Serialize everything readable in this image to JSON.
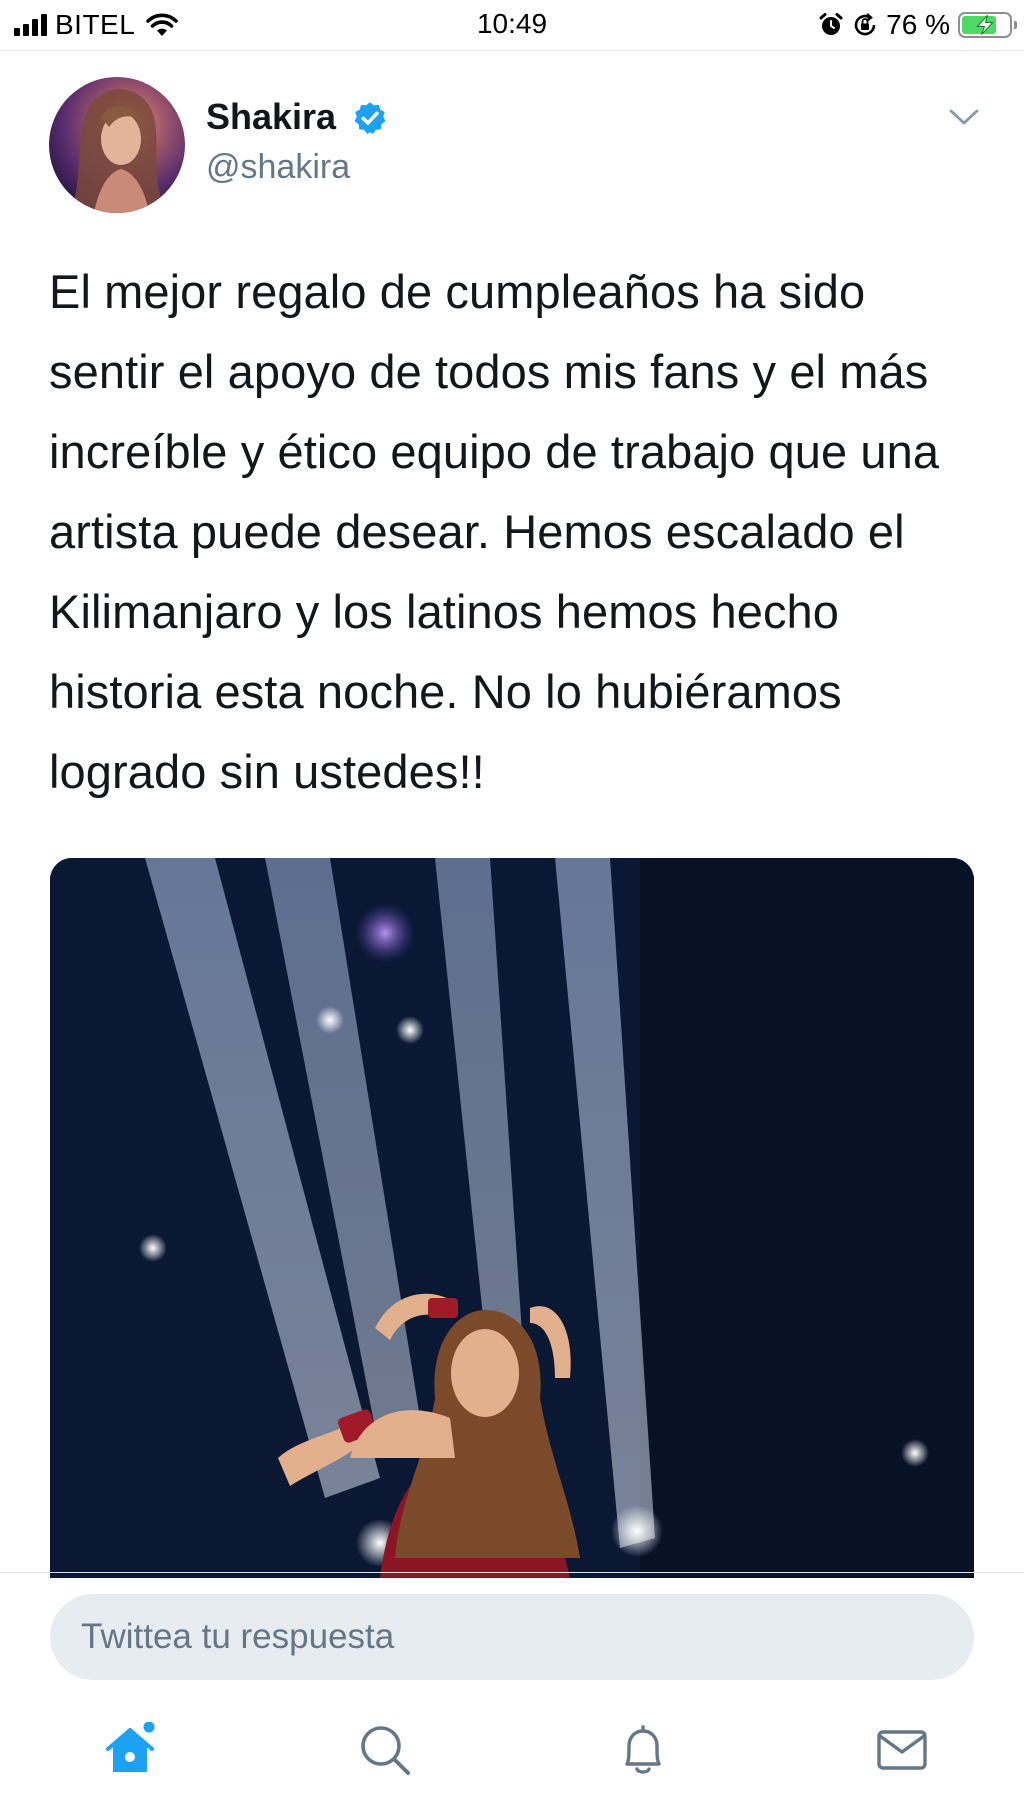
{
  "status_bar": {
    "carrier": "BITEL",
    "time": "10:49",
    "battery_percent_label": "76 %",
    "battery_level": 0.76,
    "icons": [
      "signal-icon",
      "wifi-icon",
      "alarm-icon",
      "orientation-lock-icon",
      "battery-charging-icon"
    ]
  },
  "tweet": {
    "author_name": "Shakira",
    "author_handle": "@shakira",
    "verified": true,
    "text": "El mejor regalo de cumpleaños ha sido sentir el apoyo de todos mis fans y el más increíble y ético equipo de trabajo que una artista puede desear. Hemos escalado el Kilimanjaro y los latinos hemos hecho historia esta noche. No lo hubiéramos logrado sin ustedes!!"
  },
  "reply": {
    "placeholder": "Twittea tu respuesta"
  },
  "tab_bar": {
    "tabs": [
      {
        "icon": "home-icon",
        "active": true,
        "has_notification_dot": true
      },
      {
        "icon": "search-icon",
        "active": false
      },
      {
        "icon": "notifications-bell-icon",
        "active": false
      },
      {
        "icon": "messages-envelope-icon",
        "active": false
      }
    ]
  },
  "colors": {
    "accent": "#1da1f2",
    "text_primary": "#14171a",
    "text_secondary": "#657786",
    "reply_background": "#e6ecf0",
    "inactive_icon": "#657786",
    "battery_fill": "#4cd964"
  }
}
